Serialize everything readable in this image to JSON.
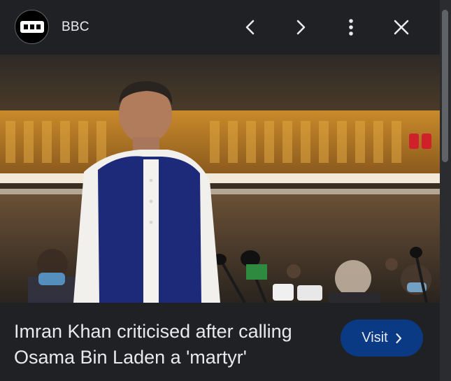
{
  "source": {
    "name": "BBC",
    "logo_icon": "bbc-logo-icon"
  },
  "header": {
    "prev_icon": "chevron-left-icon",
    "next_icon": "chevron-right-icon",
    "more_icon": "more-vert-icon",
    "close_icon": "close-icon"
  },
  "image": {
    "lens_icon": "google-lens-icon"
  },
  "caption": {
    "headline": "Imran Khan criticised after calling Osama Bin Laden a 'martyr'",
    "visit_label": "Visit",
    "visit_icon": "chevron-right-icon"
  },
  "colors": {
    "background": "#202124",
    "visit_button": "#0b3a84",
    "text": "#e8eaed"
  }
}
